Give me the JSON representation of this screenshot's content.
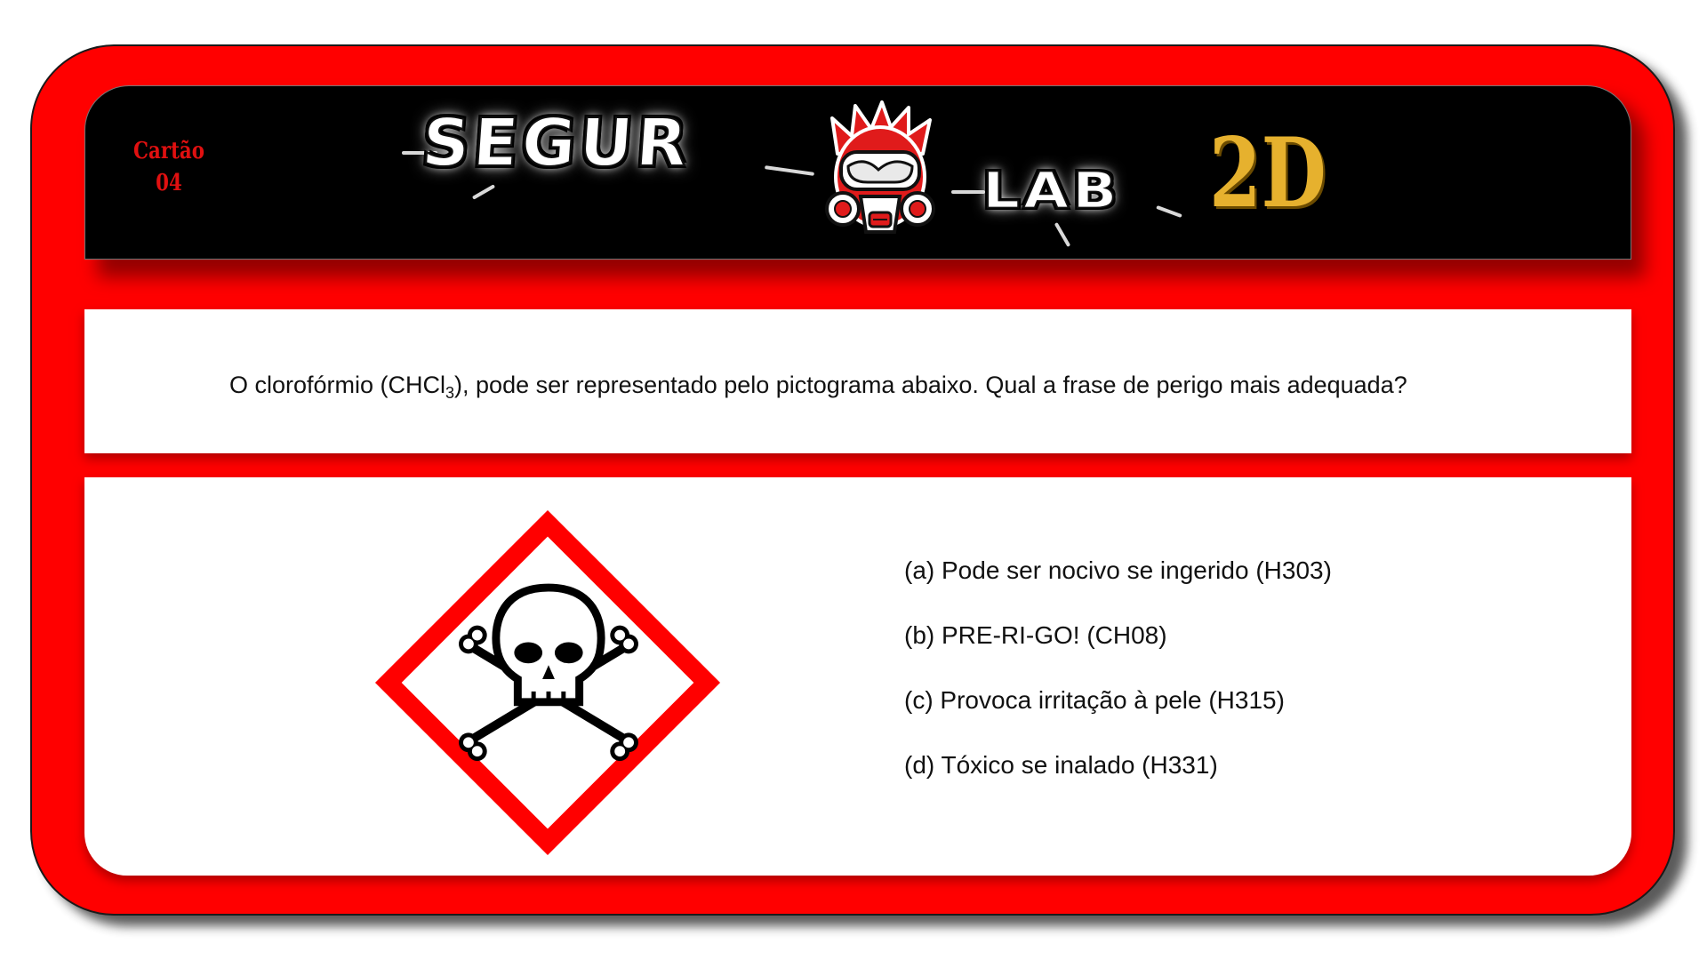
{
  "card": {
    "label_line1": "Cartão",
    "label_line2": "04"
  },
  "logo": {
    "word1": "SEGUR",
    "word2": "LAB",
    "suffix": "2D",
    "mascot_icon": "gas-mask-mascot-icon"
  },
  "question": {
    "text_before": "O clorofórmio (CHCl",
    "subscript": "3",
    "text_after": "), pode ser representado pelo pictograma abaixo. Qual a frase de perigo mais adequada?"
  },
  "pictogram": {
    "icon": "skull-crossbones-ghs-icon",
    "border_color": "#ff0000"
  },
  "options": [
    "(a) Pode ser nocivo se ingerido (H303)",
    "(b) PRE-RI-GO! (CH08)",
    "(c) Provoca irritação à pele (H315)",
    "(d) Tóxico se inalado (H331)"
  ],
  "colors": {
    "card_red": "#ff0000",
    "header_black": "#000000",
    "accent_gold": "#e6b12e",
    "label_red": "#e01010"
  }
}
